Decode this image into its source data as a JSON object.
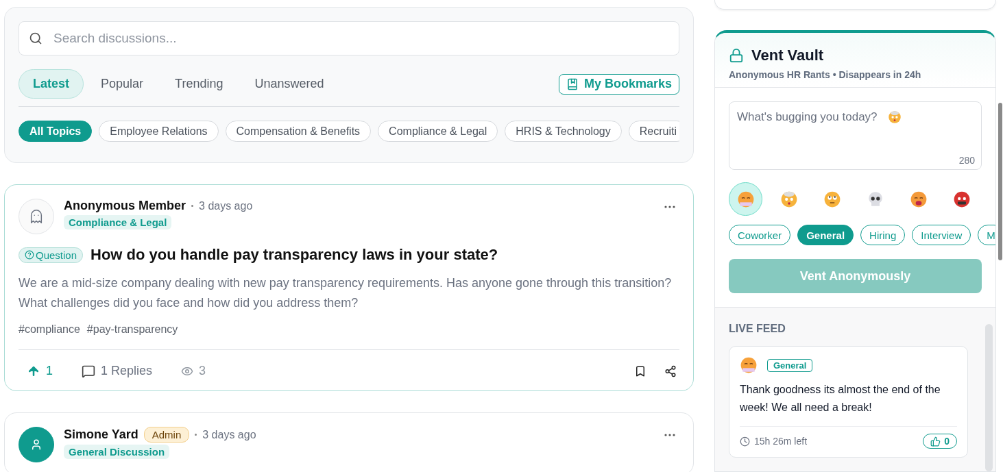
{
  "search": {
    "placeholder": "Search discussions..."
  },
  "tabs": [
    {
      "label": "Latest",
      "selected": true
    },
    {
      "label": "Popular",
      "selected": false
    },
    {
      "label": "Trending",
      "selected": false
    },
    {
      "label": "Unanswered",
      "selected": false
    }
  ],
  "bookmarks_button": "My Bookmarks",
  "topics": [
    {
      "label": "All Topics",
      "selected": true
    },
    {
      "label": "Employee Relations",
      "selected": false
    },
    {
      "label": "Compensation & Benefits",
      "selected": false
    },
    {
      "label": "Compliance & Legal",
      "selected": false
    },
    {
      "label": "HRIS & Technology",
      "selected": false
    },
    {
      "label": "Recruiti",
      "selected": false
    }
  ],
  "posts": [
    {
      "avatar": {
        "kind": "ghost"
      },
      "author": "Anonymous Member",
      "time": "3 days ago",
      "category": "Compliance & Legal",
      "type": "Question",
      "title": "How do you handle pay transparency laws in your state?",
      "body": "We are a mid-size company dealing with new pay transparency requirements. Has anyone gone through this transition? What challenges did you face and how did you address them?",
      "tags": [
        "#compliance",
        "#pay-transparency"
      ],
      "upvoted": true,
      "votes": "1",
      "replies": "1 Replies",
      "views": "3"
    },
    {
      "avatar": {
        "kind": "person"
      },
      "author": "Simone Yard",
      "role": "Admin",
      "time": "3 days ago",
      "category": "General Discussion"
    }
  ],
  "vent_vault": {
    "title": "Vent Vault",
    "subtitle": "Anonymous HR Rants • Disappears in 24h",
    "placeholder": "What's bugging you today?",
    "counter": "280",
    "moods": [
      {
        "kind": "steaming",
        "selected": true
      },
      {
        "kind": "exploding",
        "selected": false
      },
      {
        "kind": "eyeroll",
        "selected": false
      },
      {
        "kind": "skull",
        "selected": false
      },
      {
        "kind": "weary",
        "selected": false
      },
      {
        "kind": "cursing",
        "selected": false
      }
    ],
    "categories": [
      {
        "label": "Coworker",
        "selected": false
      },
      {
        "label": "General",
        "selected": true
      },
      {
        "label": "Hiring",
        "selected": false
      },
      {
        "label": "Interview",
        "selected": false
      },
      {
        "label": "M",
        "selected": false
      }
    ],
    "submit": {
      "label": "Vent Anonymously",
      "disabled": true
    }
  },
  "live_feed": {
    "heading": "LIVE FEED",
    "items": [
      {
        "mood": {
          "kind": "steaming"
        },
        "category": "General",
        "text": "Thank goodness its almost the end of the week! We all need a break!",
        "time_left": "15h 26m left",
        "likes": "0"
      }
    ]
  }
}
